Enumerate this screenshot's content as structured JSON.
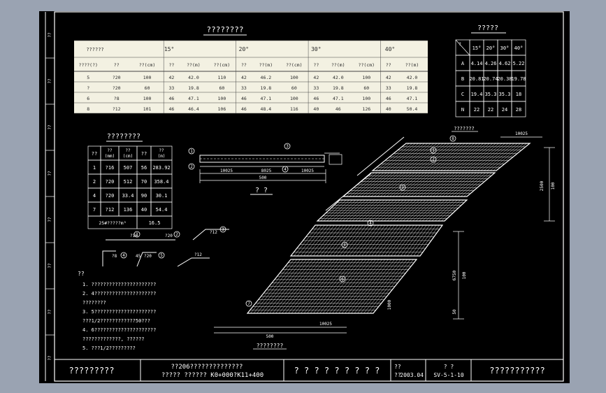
{
  "sheet": {
    "left_strip": [
      "??",
      "??",
      "??",
      "??",
      "??",
      "??",
      "??",
      "??"
    ]
  },
  "table1": {
    "title": "????????",
    "header": {
      "row1_label": "??????",
      "angles": [
        "15°",
        "20°",
        "30°",
        "40°"
      ],
      "row2": [
        "????(?)",
        "??",
        "??(cm)",
        "??",
        "??(m)",
        "??(cm)",
        "??",
        "??(m)",
        "??(cm)",
        "??",
        "??(m)",
        "??(cm)",
        "??",
        "??(m)"
      ]
    },
    "rows": [
      [
        "5",
        "?20",
        "100",
        "42",
        "42.0",
        "110",
        "42",
        "46.2",
        "100",
        "42",
        "42.0",
        "100",
        "42",
        "42.0"
      ],
      [
        "?",
        "?20",
        "60",
        "33",
        "19.8",
        "60",
        "33",
        "19.8",
        "60",
        "33",
        "19.8",
        "60",
        "33",
        "19.8"
      ],
      [
        "6",
        "?8",
        "100",
        "46",
        "47.1",
        "100",
        "46",
        "47.1",
        "100",
        "46",
        "47.1",
        "100",
        "46",
        "47.1"
      ],
      [
        "8",
        "?12",
        "101",
        "46",
        "46.4",
        "106",
        "46",
        "48.4",
        "116",
        "40",
        "46",
        "126",
        "40",
        "50.4"
      ]
    ]
  },
  "table2": {
    "title": "?????",
    "header": [
      "?",
      "15°",
      "20°",
      "30°",
      "40°"
    ],
    "rows": [
      [
        "A",
        "4.14",
        "4.26",
        "4.62",
        "5.22"
      ],
      [
        "B",
        "20.81",
        "20.74",
        "20.38",
        "19.78"
      ],
      [
        "C",
        "19.4",
        "35.3",
        "35.3",
        "18"
      ],
      [
        "N",
        "22",
        "22",
        "24",
        "28"
      ]
    ]
  },
  "table3": {
    "title": "????????",
    "header": [
      "??",
      "??\n(mm)",
      "??\n(cm)",
      "??",
      "??\n(m)"
    ],
    "rows": [
      [
        "1",
        "?16",
        "507",
        "56",
        "283.92"
      ],
      [
        "2",
        "?20",
        "512",
        "70",
        "358.4"
      ],
      [
        "4",
        "?20",
        "33.4",
        "90",
        "30.1"
      ],
      [
        "7",
        "?12",
        "136",
        "40",
        "54.4"
      ]
    ],
    "footer": [
      "25#?????m³",
      "16.5"
    ]
  },
  "section": {
    "label": "? ?",
    "dims": [
      "10025",
      "8025",
      "10025",
      "500"
    ]
  },
  "plan": {
    "top_label": "???????",
    "bottom_label": "????????",
    "dims": [
      "10025",
      "10025",
      "500",
      "2500",
      "100",
      "6750",
      "100",
      "50",
      "1000"
    ],
    "markers": [
      "1",
      "2",
      "3",
      "4",
      "5",
      "6",
      "7",
      "8"
    ]
  },
  "bar_details": {
    "labels": [
      "?16",
      "?20",
      "?12",
      "?8",
      "45",
      "?20",
      "?12"
    ],
    "markers": [
      "1",
      "2",
      "3",
      "4",
      "5"
    ]
  },
  "notes": {
    "head": "??",
    "lines": [
      "1. ??????????????????????",
      "2. 4?????????????????????",
      "   ????????",
      "3. 5?????????????????????",
      "   ???1/2????????????50???",
      "4. 6?????????????????????",
      "   ?????????????,  ??????",
      "5. ???1/2?????????"
    ]
  },
  "title_block": {
    "left": "?????????",
    "project_line1": "??206??????????????",
    "project_line2": "?????  ??????  K0+000?K11+400",
    "drawing_name": "? ? ? ? ? ? ? ? ?",
    "date_label": "??",
    "date_value": "2003.04",
    "number_label": "? ?",
    "number_value": "SV-5-1-10",
    "right": "???????????"
  }
}
